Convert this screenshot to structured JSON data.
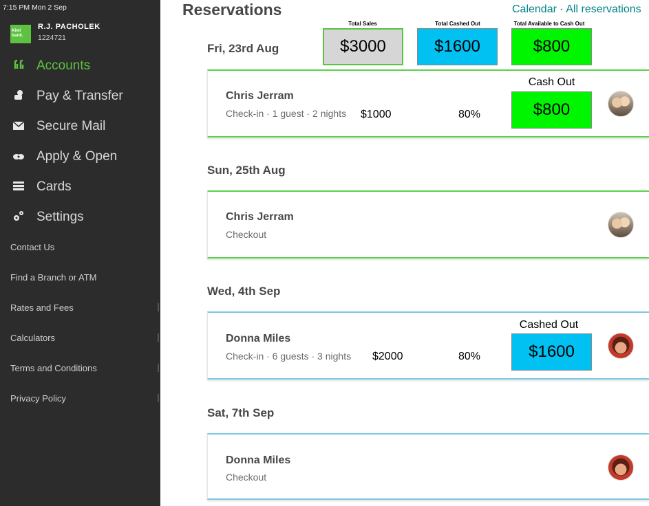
{
  "status_bar": {
    "time_date": "7:15 PM   Mon 2 Sep"
  },
  "user": {
    "logo_text": "Kiwi bank.",
    "name": "R.J. PACHOLEK",
    "id": "1224721"
  },
  "sidebar": {
    "nav": [
      {
        "label": "Accounts",
        "icon": "accounts-icon"
      },
      {
        "label": "Pay & Transfer",
        "icon": "pay-transfer-icon"
      },
      {
        "label": "Secure Mail",
        "icon": "mail-icon"
      },
      {
        "label": "Apply & Open",
        "icon": "apply-icon"
      },
      {
        "label": "Cards",
        "icon": "card-icon"
      },
      {
        "label": "Settings",
        "icon": "gear-icon"
      }
    ],
    "links": [
      "Contact Us",
      "Find a Branch or ATM",
      "Rates and Fees",
      "Calculators",
      "Terms and Conditions",
      "Privacy Policy"
    ]
  },
  "main": {
    "title": "Reservations",
    "links": {
      "calendar": "Calendar",
      "separator": "·",
      "all": "All reservations"
    },
    "summary": {
      "total_sales_label": "Total Sales",
      "total_sales": "$3000",
      "total_cashed_out_label": "Total Cashed Out",
      "total_cashed_out": "$1600",
      "total_available_label": "Total Available to Cash Out",
      "total_available": "$800"
    },
    "days": [
      {
        "date": "Fri, 23rd Aug",
        "guest": "Chris Jerram",
        "detail": "Check-in · 1 guest · 2 nights",
        "amount": "$1000",
        "percent": "80%",
        "box_label": "Cash Out",
        "box_value": "$800"
      },
      {
        "date": "Sun, 25th Aug",
        "guest": "Chris Jerram",
        "detail": "Checkout"
      },
      {
        "date": "Wed, 4th Sep",
        "guest": "Donna Miles",
        "detail": "Check-in · 6 guests · 3 nights",
        "amount": "$2000",
        "percent": "80%",
        "box_label": "Cashed Out",
        "box_value": "$1600"
      },
      {
        "date": "Sat, 7th Sep",
        "guest": "Donna Miles",
        "detail": "Checkout"
      }
    ]
  },
  "colors": {
    "accent_green": "#5cc23f",
    "cash_blue": "#00c1f2",
    "cash_green": "#00f600",
    "link_teal": "#008489",
    "sidebar_bg": "#2c2c2c"
  }
}
